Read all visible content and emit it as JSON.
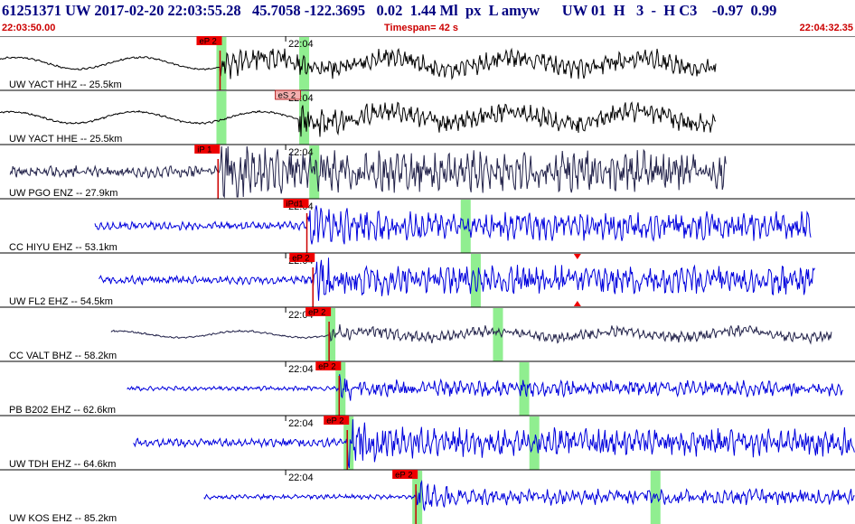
{
  "header": {
    "title": "61251371 UW 2017-02-20 22:03:55.28   45.7058 -122.3695   0.02  1.44 Ml  px  L amyw      UW 01  H   3  -  H C3    -0.97  0.99",
    "start_time": "22:03:50.00",
    "timespan": "Timespan=  42 s",
    "end_time": "22:04:32.35"
  },
  "colors": {
    "trace_black": "#000000",
    "trace_blue": "#0000dd",
    "trace_dark": "#22224a",
    "pick_box": "#ee0000",
    "pick_box_alt": "#f4b0b0",
    "green_band": "#90ee90",
    "pick_line": "#cc0000",
    "separator": "#000000"
  },
  "chart_data": {
    "type": "seismogram",
    "x_start": "22:03:50.00",
    "x_end": "22:04:32.35",
    "x_range_s": [
      0,
      42.35
    ],
    "panels": [
      {
        "label": "UW YACT HHZ -- 25.5km",
        "tick_label": "22:04",
        "color": "black",
        "amplitude": "medium",
        "trace_start_s": 0.0,
        "trace_end_s": 35.5,
        "pick_label": "eP 2",
        "pick_time_s": 10.9,
        "pick_style": "red",
        "pick_line": true,
        "bands_s": [
          10.9,
          15.0
        ],
        "event_s": 22.6
      },
      {
        "label": "UW YACT HHE -- 25.5km",
        "tick_label": "22:04",
        "color": "black",
        "amplitude": "medium",
        "trace_start_s": 0.0,
        "trace_end_s": 35.5,
        "pick_label": "eS 2",
        "pick_time_s": 14.8,
        "pick_style": "pink",
        "pick_line": false,
        "bands_s": [
          10.9,
          15.0
        ],
        "event_s": 22.6
      },
      {
        "label": "UW PGO ENZ -- 27.9km",
        "tick_label": "22:04",
        "color": "dark",
        "amplitude": "high",
        "trace_start_s": 0.5,
        "trace_end_s": 36.0,
        "pick_label": "iP 1",
        "pick_time_s": 10.8,
        "pick_style": "red",
        "pick_line": true,
        "bands_s": [
          15.5
        ]
      },
      {
        "label": "CC HIYU EHZ -- 53.1km",
        "tick_label": "22:04",
        "color": "blue",
        "amplitude": "medium",
        "trace_start_s": 4.7,
        "trace_end_s": 40.2,
        "pick_label": "iPd1",
        "pick_time_s": 15.2,
        "pick_style": "red",
        "pick_line": true,
        "bands_s": [
          23.0
        ]
      },
      {
        "label": "UW FL2 EHZ -- 54.5km",
        "tick_label": "22:04",
        "color": "blue",
        "amplitude": "medium",
        "trace_start_s": 4.9,
        "trace_end_s": 40.4,
        "pick_label": "eP 2",
        "pick_time_s": 15.5,
        "pick_style": "red",
        "pick_line": true,
        "bands_s": [
          23.5
        ],
        "marker_s": 28.6
      },
      {
        "label": "CC VALT BHZ -- 58.2km",
        "tick_label": "22:04",
        "color": "dark",
        "amplitude": "low",
        "trace_start_s": 5.5,
        "trace_end_s": 41.2,
        "pick_label": "eP 2",
        "pick_time_s": 16.3,
        "pick_style": "red",
        "pick_line": true,
        "bands_s": [
          16.3,
          24.6
        ]
      },
      {
        "label": "PB B202 EHZ -- 62.6km",
        "tick_label": "22:04",
        "color": "blue",
        "amplitude": "low",
        "trace_start_s": 6.3,
        "trace_end_s": 41.8,
        "pick_label": "eP 2",
        "pick_time_s": 16.8,
        "pick_style": "red",
        "pick_line": true,
        "bands_s": [
          16.8,
          25.9
        ]
      },
      {
        "label": "UW TDH EHZ -- 64.6km",
        "tick_label": "22:04",
        "color": "blue",
        "amplitude": "medium",
        "trace_start_s": 6.6,
        "trace_end_s": 42.35,
        "pick_label": "eP 2",
        "pick_time_s": 17.2,
        "pick_style": "red",
        "pick_line": true,
        "bands_s": [
          17.2,
          26.4
        ]
      },
      {
        "label": "UW KOS EHZ -- 85.2km",
        "tick_label": "22:04",
        "color": "blue",
        "amplitude": "low",
        "trace_start_s": 10.1,
        "trace_end_s": 42.35,
        "pick_label": "eP 2",
        "pick_time_s": 20.6,
        "pick_style": "red",
        "pick_line": true,
        "bands_s": [
          20.6,
          32.4
        ]
      }
    ]
  }
}
